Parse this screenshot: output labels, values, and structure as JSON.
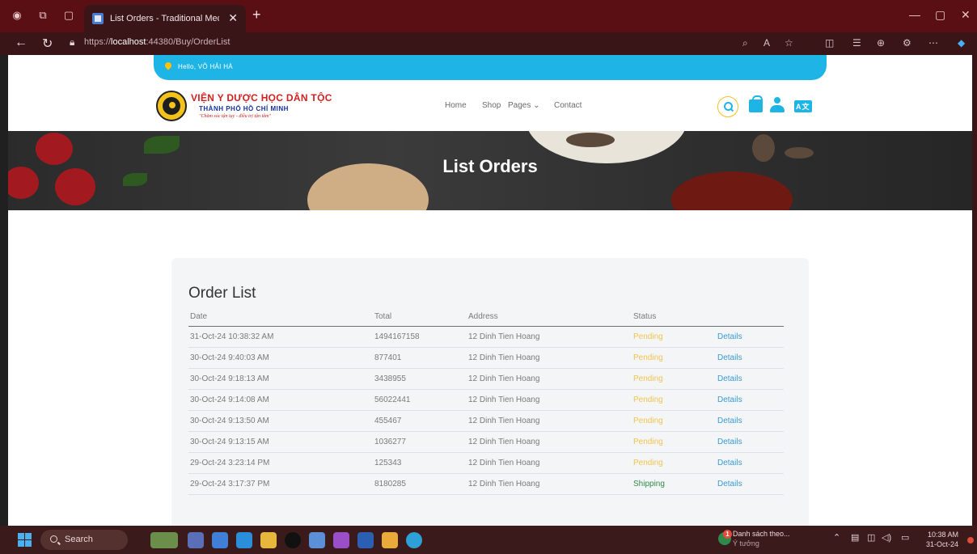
{
  "browser": {
    "tab_title": "List Orders - Traditional Medicine",
    "url_prefix": "https://",
    "url_host": "localhost",
    "url_rest": ":44380/Buy/OrderList"
  },
  "site": {
    "greeting": "Hello, VÕ HẢI HÀ",
    "logo_line1": "VIỆN Y DƯỢC HỌC DÂN TỘC",
    "logo_line2": "THÀNH PHỐ HỒ CHÍ MINH",
    "logo_line3": "\"Chăm sóc tận tụy - điều trị tận tâm\"",
    "nav": {
      "home": "Home",
      "shop": "Shop",
      "pages": "Pages ⌄",
      "contact": "Contact"
    },
    "lang_label": "A文"
  },
  "hero": {
    "title": "List Orders"
  },
  "orders": {
    "heading": "Order List",
    "columns": {
      "date": "Date",
      "total": "Total",
      "address": "Address",
      "status": "Status"
    },
    "rows": [
      {
        "date": "31-Oct-24 10:38:32 AM",
        "total": "1494167158",
        "address": "12 Dinh Tien Hoang",
        "status": "Pending",
        "action": "Details"
      },
      {
        "date": "30-Oct-24 9:40:03 AM",
        "total": "877401",
        "address": "12 Dinh Tien Hoang",
        "status": "Pending",
        "action": "Details"
      },
      {
        "date": "30-Oct-24 9:18:13 AM",
        "total": "3438955",
        "address": "12 Dinh Tien Hoang",
        "status": "Pending",
        "action": "Details"
      },
      {
        "date": "30-Oct-24 9:14:08 AM",
        "total": "56022441",
        "address": "12 Dinh Tien Hoang",
        "status": "Pending",
        "action": "Details"
      },
      {
        "date": "30-Oct-24 9:13:50 AM",
        "total": "455467",
        "address": "12 Dinh Tien Hoang",
        "status": "Pending",
        "action": "Details"
      },
      {
        "date": "30-Oct-24 9:13:15 AM",
        "total": "1036277",
        "address": "12 Dinh Tien Hoang",
        "status": "Pending",
        "action": "Details"
      },
      {
        "date": "29-Oct-24 3:23:14 PM",
        "total": "125343",
        "address": "12 Dinh Tien Hoang",
        "status": "Pending",
        "action": "Details"
      },
      {
        "date": "29-Oct-24 3:17:37 PM",
        "total": "8180285",
        "address": "12 Dinh Tien Hoang",
        "status": "Shipping",
        "action": "Details"
      }
    ]
  },
  "taskbar": {
    "search_label": "Search",
    "notification_title": "Danh sách theo...",
    "notification_sub": "Ý tưởng",
    "notification_count": "1",
    "time": "10:38 AM",
    "date": "31-Oct-24"
  },
  "colors": {
    "accent": "#1eb4e6",
    "pending": "#f3c44e",
    "shipping": "#2f8a4a",
    "link": "#3a9bd1",
    "browser_frame": "#5a0f14"
  }
}
